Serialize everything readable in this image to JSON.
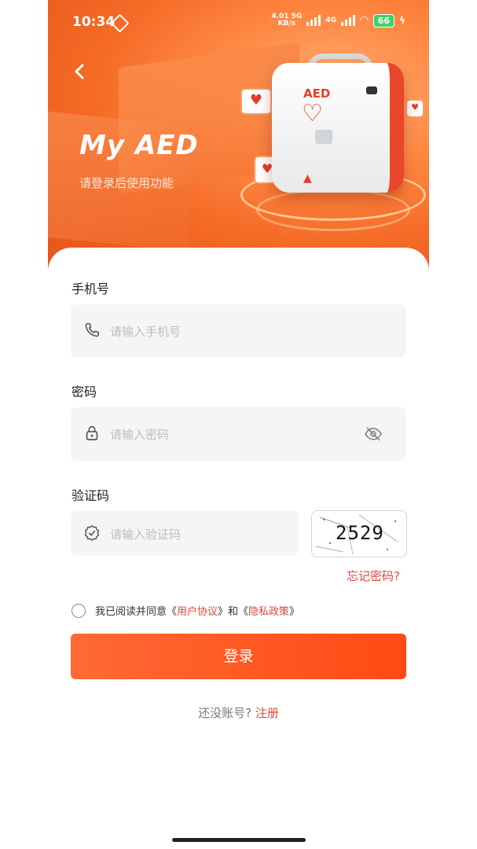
{
  "status_bar": {
    "time": "10:34",
    "speed": "4.01",
    "speed_unit": "KB/s",
    "net1": "5G",
    "net2": "4G",
    "battery": "66"
  },
  "header": {
    "title": "My AED",
    "subtitle": "请登录后使用功能",
    "device_label": "AED"
  },
  "form": {
    "phone_label": "手机号",
    "phone_placeholder": "请输入手机号",
    "password_label": "密码",
    "password_placeholder": "请输入密码",
    "captcha_label": "验证码",
    "captcha_placeholder": "请输入验证码",
    "captcha_code": "2529",
    "forgot_password": "忘记密码?",
    "agree_prefix": "我已阅读并同意《",
    "user_agreement": "用户协议",
    "agree_mid": "》和《",
    "privacy_policy": "隐私政策",
    "agree_suffix": "》",
    "login_button": "登录",
    "no_account": "还没账号?",
    "register": "注册"
  },
  "colors": {
    "accent": "#ff5a22",
    "link": "#e0473a"
  }
}
